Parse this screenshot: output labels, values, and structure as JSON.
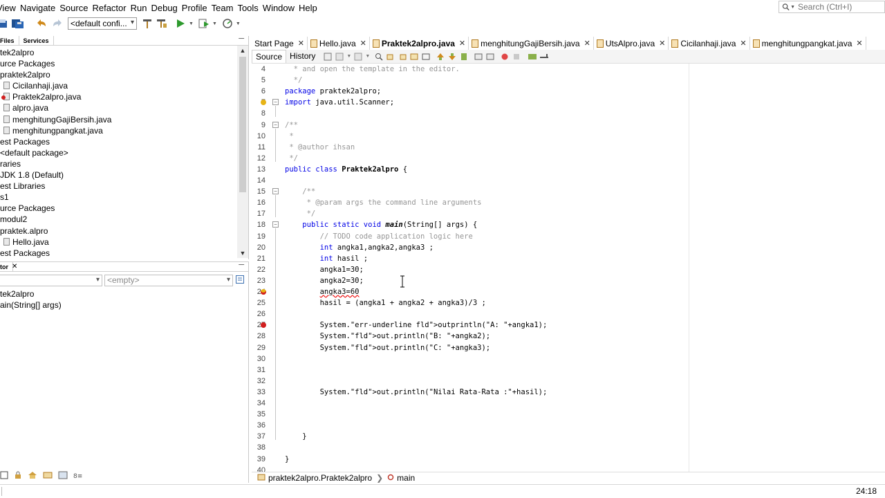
{
  "menubar": [
    "View",
    "Navigate",
    "Source",
    "Refactor",
    "Run",
    "Debug",
    "Profile",
    "Team",
    "Tools",
    "Window",
    "Help"
  ],
  "search": {
    "placeholder": "Search (Ctrl+I)"
  },
  "toolbar": {
    "config": "<default confi..."
  },
  "projects_panel": {
    "tabs": [
      "Files",
      "Services"
    ],
    "tree": [
      {
        "label": "tek2alpro",
        "indent": 0,
        "icon": ""
      },
      {
        "label": "urce Packages",
        "indent": 0,
        "icon": ""
      },
      {
        "label": "praktek2alpro",
        "indent": 0,
        "icon": ""
      },
      {
        "label": "Cicilanhaji.java",
        "indent": 1,
        "icon": "java"
      },
      {
        "label": "Praktek2alpro.java",
        "indent": 1,
        "icon": "java-error"
      },
      {
        "label": "alpro.java",
        "indent": 1,
        "icon": "java"
      },
      {
        "label": "menghitungGajiBersih.java",
        "indent": 1,
        "icon": "java"
      },
      {
        "label": "menghitungpangkat.java",
        "indent": 1,
        "icon": "java"
      },
      {
        "label": "est Packages",
        "indent": 0,
        "icon": ""
      },
      {
        "label": "<default package>",
        "indent": 0,
        "icon": ""
      },
      {
        "label": "raries",
        "indent": 0,
        "icon": ""
      },
      {
        "label": "JDK 1.8 (Default)",
        "indent": 0,
        "icon": ""
      },
      {
        "label": "est Libraries",
        "indent": 0,
        "icon": ""
      },
      {
        "label": "s1",
        "indent": 0,
        "icon": ""
      },
      {
        "label": "urce Packages",
        "indent": 0,
        "icon": ""
      },
      {
        "label": "modul2",
        "indent": 0,
        "icon": ""
      },
      {
        "label": "praktek.alpro",
        "indent": 0,
        "icon": ""
      },
      {
        "label": "Hello.java",
        "indent": 1,
        "icon": "java"
      },
      {
        "label": "est Packages",
        "indent": 0,
        "icon": ""
      }
    ]
  },
  "navigator": {
    "title": "tor",
    "filter_value": "",
    "member_placeholder": "<empty>",
    "items": [
      "tek2alpro",
      "ain(String[] args)"
    ]
  },
  "editor": {
    "tabs": [
      {
        "label": "Start Page",
        "active": false
      },
      {
        "label": "Hello.java",
        "active": false
      },
      {
        "label": "Praktek2alpro.java",
        "active": true
      },
      {
        "label": "menghitungGajiBersih.java",
        "active": false
      },
      {
        "label": "UtsAlpro.java",
        "active": false
      },
      {
        "label": "Cicilanhaji.java",
        "active": false
      },
      {
        "label": "menghitungpangkat.java",
        "active": false
      }
    ],
    "view_tabs": [
      "Source",
      "History"
    ],
    "lines": [
      {
        "n": "4",
        "t": "  * and open the template in the editor.",
        "cls": "cm"
      },
      {
        "n": "5",
        "t": "  */",
        "cls": "cm"
      },
      {
        "n": "6",
        "t": "package praktek2alpro;",
        "cls": "pkg"
      },
      {
        "n": "7",
        "t": "import java.util.Scanner;",
        "cls": "imp"
      },
      {
        "n": "8",
        "t": "",
        "cls": ""
      },
      {
        "n": "9",
        "t": "/**",
        "cls": "cm"
      },
      {
        "n": "10",
        "t": " *",
        "cls": "cm"
      },
      {
        "n": "11",
        "t": " * @author ihsan",
        "cls": "cm"
      },
      {
        "n": "12",
        "t": " */",
        "cls": "cm"
      },
      {
        "n": "13",
        "t": "public class Praktek2alpro {",
        "cls": "cls"
      },
      {
        "n": "14",
        "t": "",
        "cls": ""
      },
      {
        "n": "15",
        "t": "    /**",
        "cls": "cm"
      },
      {
        "n": "16",
        "t": "     * @param args the command line arguments",
        "cls": "cm"
      },
      {
        "n": "17",
        "t": "     */",
        "cls": "cm"
      },
      {
        "n": "18",
        "t": "    public static void main(String[] args) {",
        "cls": "main"
      },
      {
        "n": "19",
        "t": "        // TODO code application logic here",
        "cls": "cm"
      },
      {
        "n": "20",
        "t": "        int angka1,angka2,angka3 ;",
        "cls": "int"
      },
      {
        "n": "21",
        "t": "        int hasil ;",
        "cls": "int"
      },
      {
        "n": "22",
        "t": "        angka1=30;",
        "cls": ""
      },
      {
        "n": "23",
        "t": "        angka2=30;",
        "cls": ""
      },
      {
        "n": "24",
        "t": "        angka3=60",
        "cls": "errline"
      },
      {
        "n": "25",
        "t": "        hasil = (angka1 + angka2 + angka3)/3 ;",
        "cls": ""
      },
      {
        "n": "26",
        "t": "",
        "cls": ""
      },
      {
        "n": "27",
        "t": "        System.outprintln(\"A: \"+angka1);",
        "cls": "p27"
      },
      {
        "n": "28",
        "t": "        System.out.println(\"B: \"+angka2);",
        "cls": "p28"
      },
      {
        "n": "29",
        "t": "        System.out.println(\"C: \"+angka3);",
        "cls": "p29"
      },
      {
        "n": "30",
        "t": "",
        "cls": ""
      },
      {
        "n": "31",
        "t": "",
        "cls": ""
      },
      {
        "n": "32",
        "t": "",
        "cls": ""
      },
      {
        "n": "33",
        "t": "        System.out.println(\"Nilai Rata-Rata :\"+hasil);",
        "cls": "p33"
      },
      {
        "n": "34",
        "t": "",
        "cls": ""
      },
      {
        "n": "35",
        "t": "",
        "cls": ""
      },
      {
        "n": "36",
        "t": "",
        "cls": ""
      },
      {
        "n": "37",
        "t": "    }",
        "cls": ""
      },
      {
        "n": "38",
        "t": "",
        "cls": ""
      },
      {
        "n": "39",
        "t": "}",
        "cls": ""
      },
      {
        "n": "40",
        "t": "",
        "cls": ""
      }
    ]
  },
  "breadcrumb": {
    "class": "praktek2alpro.Praktek2alpro",
    "method": "main"
  },
  "status": {
    "position": "24:18"
  },
  "colors": {
    "keyword": "#0000e6",
    "comment": "#969696",
    "string": "#ce7b00",
    "field": "#009900",
    "error": "#d21f1f"
  }
}
